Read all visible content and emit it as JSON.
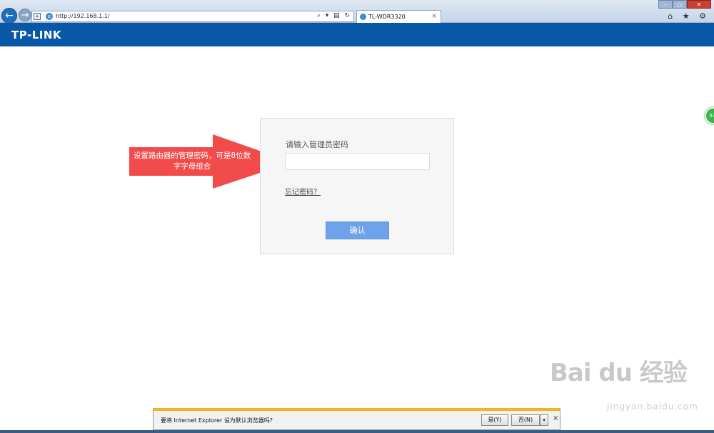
{
  "browser": {
    "url": "http://192.168.1.1/",
    "tab_title": "TL-WDR3320",
    "tab_close": "×",
    "back_glyph": "←",
    "forward_glyph": "→",
    "address_tools": "⌕ ▾ ▤ ↻",
    "right_tools": "⌂ ★ ⚙",
    "win_min": "–",
    "win_max": "▢",
    "win_close": "✕"
  },
  "header": {
    "logo": "TP-LINK",
    "brand_color": "#0958a8"
  },
  "annotation": {
    "text": "设置路由器的管理密码，可是8位数字字母组合",
    "color": "#f24b4b"
  },
  "login": {
    "password_label": "请输入管理员密码",
    "password_value": "",
    "forgot_link": "忘记密码？",
    "confirm_button": "确认",
    "accent_color": "#6ea2ea"
  },
  "side_badge": "33",
  "watermark": {
    "text": "Bai du 经验",
    "sub": "jingyan.baidu.com"
  },
  "notification": {
    "message": "要将 Internet Explorer 设为默认浏览器吗?",
    "yes": "是(Y)",
    "no": "否(N)",
    "dropdown": "▾",
    "close": "×"
  }
}
